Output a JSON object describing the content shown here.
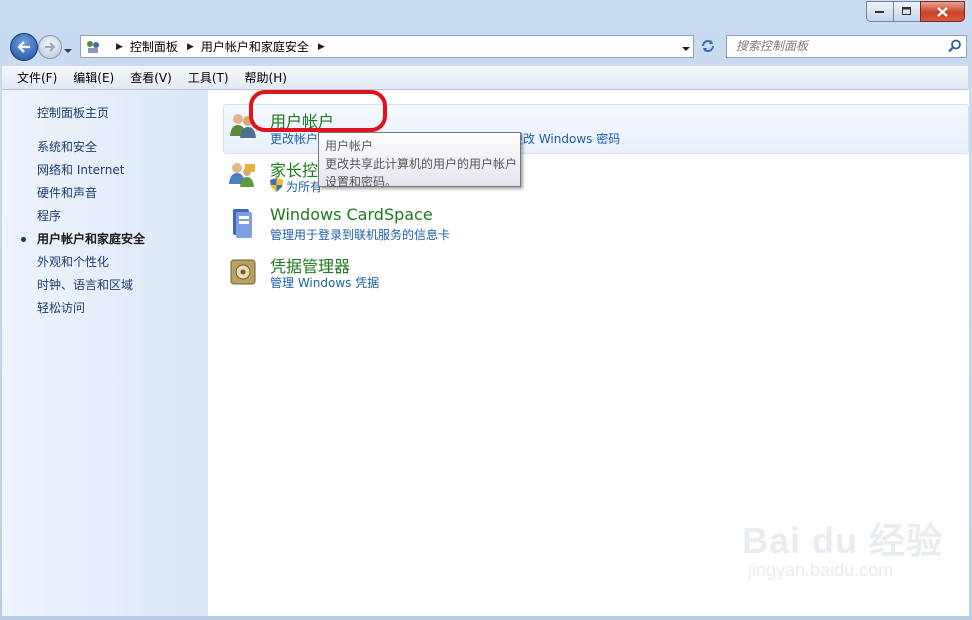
{
  "window": {
    "controls": {
      "minimize": "minimize-icon",
      "maximize": "maximize-icon",
      "close": "close-icon"
    }
  },
  "navbar": {
    "breadcrumbs": [
      "控制面板",
      "用户帐户和家庭安全"
    ],
    "search_placeholder": "搜索控制面板"
  },
  "menubar": {
    "items": [
      "文件(F)",
      "编辑(E)",
      "查看(V)",
      "工具(T)",
      "帮助(H)"
    ]
  },
  "sidebar": {
    "home": "控制面板主页",
    "items": [
      {
        "label": "系统和安全",
        "active": false
      },
      {
        "label": "网络和 Internet",
        "active": false
      },
      {
        "label": "硬件和声音",
        "active": false
      },
      {
        "label": "程序",
        "active": false
      },
      {
        "label": "用户帐户和家庭安全",
        "active": true
      },
      {
        "label": "外观和个性化",
        "active": false
      },
      {
        "label": "时钟、语言和区域",
        "active": false
      },
      {
        "label": "轻松访问",
        "active": false
      }
    ]
  },
  "categories": [
    {
      "title": "用户帐户",
      "links": [
        "更改帐户",
        "更改 Windows 密码"
      ],
      "icon": "users-icon"
    },
    {
      "title": "家长控",
      "links": [
        "为所有"
      ],
      "icon": "parental-controls-icon"
    },
    {
      "title": "Windows CardSpace",
      "links": [
        "管理用于登录到联机服务的信息卡"
      ],
      "icon": "cardspace-icon"
    },
    {
      "title": "凭据管理器",
      "links": [
        "管理 Windows 凭据"
      ],
      "icon": "vault-icon"
    }
  ],
  "tooltip": {
    "title": "用户帐户",
    "line1": "更改共享此计算机的用户的用户帐户",
    "line2": "设置和密码。"
  },
  "watermark": {
    "logo": "Bai du 经验",
    "url": "jingyan.baidu.com"
  },
  "colors": {
    "category_title": "#1b7a1b",
    "link": "#1c5ea8",
    "annotation": "#e0121b"
  }
}
